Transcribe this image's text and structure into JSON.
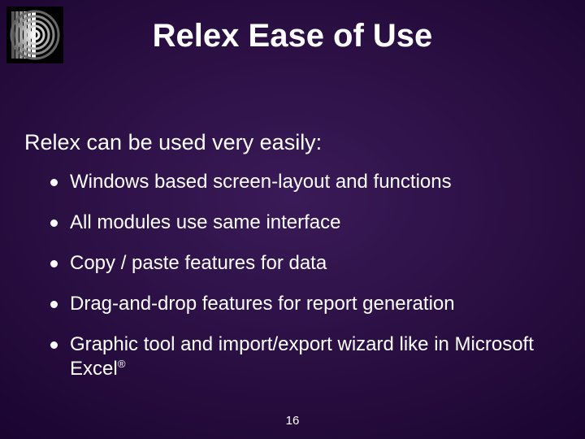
{
  "title": "Relex Ease of Use",
  "subhead": "Relex can be used very easily:",
  "bullets": [
    "Windows based screen-layout and functions",
    "All modules use same interface",
    "Copy / paste features for data",
    "Drag-and-drop features for report generation",
    "Graphic tool and import/export wizard like in Microsoft Excel"
  ],
  "registered_suffix": "®",
  "page_number": "16"
}
